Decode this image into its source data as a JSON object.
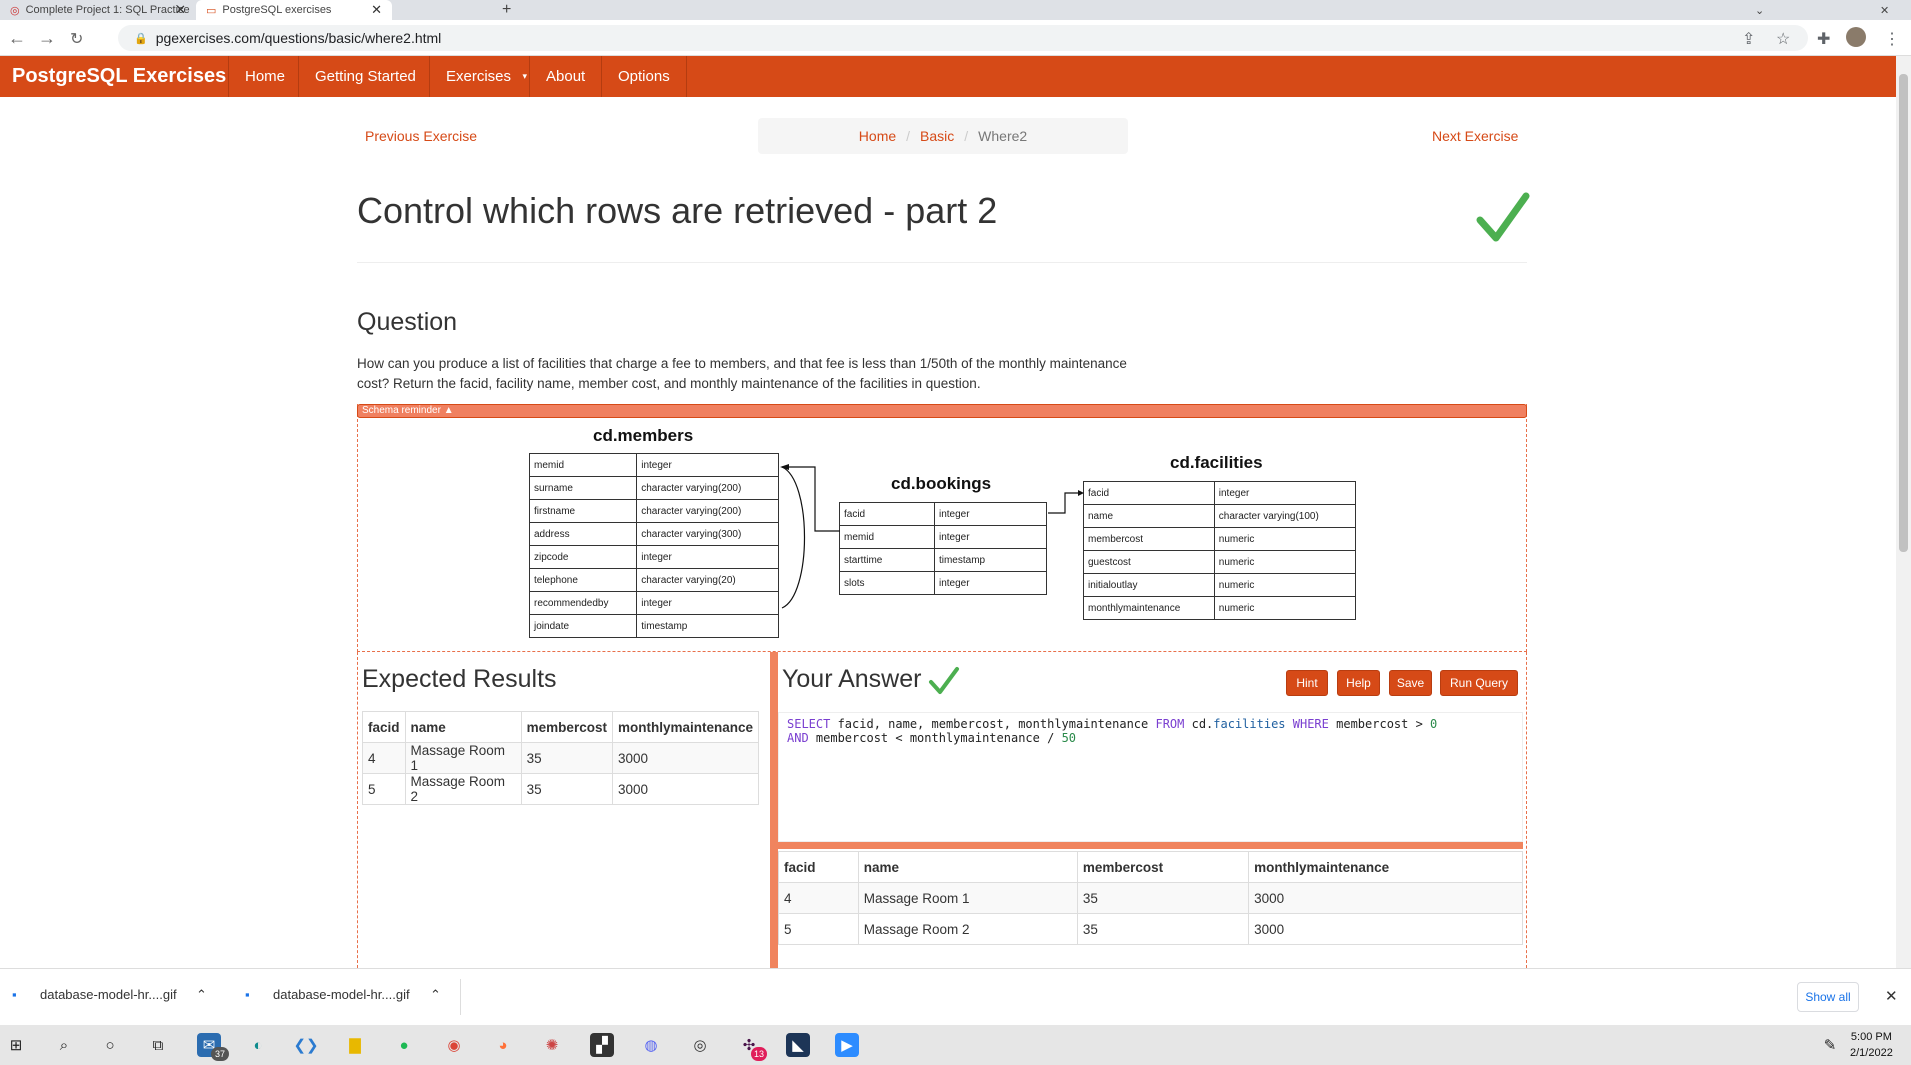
{
  "browser": {
    "tabs": [
      {
        "title": "Complete Project 1: SQL Practice"
      },
      {
        "title": "PostgreSQL exercises"
      }
    ],
    "url": "pgexercises.com/questions/basic/where2.html"
  },
  "navbar": {
    "brand": "PostgreSQL Exercises",
    "items": [
      "Home",
      "Getting Started",
      "Exercises",
      "About",
      "Options"
    ]
  },
  "pager": {
    "prev": "Previous Exercise",
    "next": "Next Exercise",
    "breadcrumb": [
      "Home",
      "Basic",
      "Where2"
    ]
  },
  "page": {
    "title": "Control which rows are retrieved - part 2",
    "question_heading": "Question",
    "question_text": "How can you produce a list of facilities that charge a fee to members, and that fee is less than 1/50th of the monthly maintenance cost? Return the facid, facility name, member cost, and monthly maintenance of the facilities in question.",
    "schema_toggle": "Schema reminder ▲"
  },
  "schema": {
    "members": {
      "name": "cd.members",
      "rows": [
        [
          "memid",
          "integer"
        ],
        [
          "surname",
          "character varying(200)"
        ],
        [
          "firstname",
          "character varying(200)"
        ],
        [
          "address",
          "character varying(300)"
        ],
        [
          "zipcode",
          "integer"
        ],
        [
          "telephone",
          "character varying(20)"
        ],
        [
          "recommendedby",
          "integer"
        ],
        [
          "joindate",
          "timestamp"
        ]
      ]
    },
    "bookings": {
      "name": "cd.bookings",
      "rows": [
        [
          "facid",
          "integer"
        ],
        [
          "memid",
          "integer"
        ],
        [
          "starttime",
          "timestamp"
        ],
        [
          "slots",
          "integer"
        ]
      ]
    },
    "facilities": {
      "name": "cd.facilities",
      "rows": [
        [
          "facid",
          "integer"
        ],
        [
          "name",
          "character varying(100)"
        ],
        [
          "membercost",
          "numeric"
        ],
        [
          "guestcost",
          "numeric"
        ],
        [
          "initialoutlay",
          "numeric"
        ],
        [
          "monthlymaintenance",
          "numeric"
        ]
      ]
    }
  },
  "expected": {
    "heading": "Expected Results",
    "columns": [
      "facid",
      "name",
      "membercost",
      "monthlymaintenance"
    ],
    "rows": [
      [
        "4",
        "Massage Room 1",
        "35",
        "3000"
      ],
      [
        "5",
        "Massage Room 2",
        "35",
        "3000"
      ]
    ]
  },
  "answer": {
    "heading": "Your Answer",
    "buttons": {
      "hint": "Hint",
      "help": "Help",
      "save": "Save",
      "run": "Run Query"
    },
    "sql": {
      "l1_kw1": "SELECT",
      "l1_cols": " facid, name, membercost, monthlymaintenance ",
      "l1_kw2": "FROM",
      "l1_schema": " cd.",
      "l1_table": "facilities",
      "l1_kw3": " WHERE",
      "l1_cond": " membercost > ",
      "l1_num": "0",
      "l2_kw": "AND",
      "l2_cond": " membercost < monthlymaintenance / ",
      "l2_num": "50"
    },
    "columns": [
      "facid",
      "name",
      "membercost",
      "monthlymaintenance"
    ],
    "rows": [
      [
        "4",
        "Massage Room 1",
        "35",
        "3000"
      ],
      [
        "5",
        "Massage Room 2",
        "35",
        "3000"
      ]
    ]
  },
  "downloads": {
    "items": [
      "database-model-hr....gif",
      "database-model-hr....gif"
    ],
    "show_all": "Show all"
  },
  "taskbar": {
    "mail_badge": "37",
    "slack_badge": "13",
    "time": "5:00 PM",
    "date": "2/1/2022"
  },
  "colors": {
    "accent": "#d64a17",
    "success": "#4caf50"
  }
}
